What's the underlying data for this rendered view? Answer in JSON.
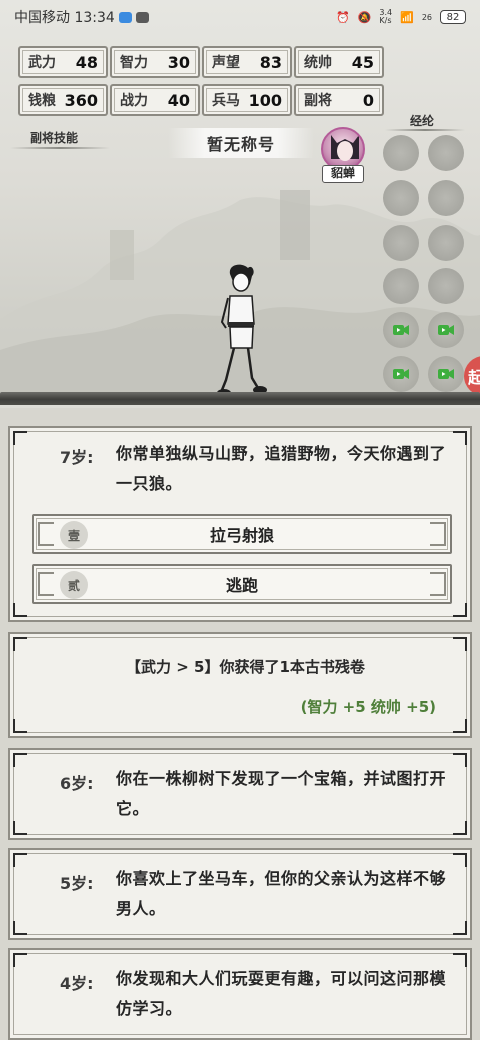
{
  "status_bar": {
    "carrier_time": "中国移动 13:34",
    "network_speed": "3.4\nK/s",
    "signal": "26",
    "battery": "82"
  },
  "stats": [
    {
      "label": "武力",
      "value": "48"
    },
    {
      "label": "智力",
      "value": "30"
    },
    {
      "label": "声望",
      "value": "83"
    },
    {
      "label": "统帅",
      "value": "45"
    },
    {
      "label": "钱粮",
      "value": "360"
    },
    {
      "label": "战力",
      "value": "40"
    },
    {
      "label": "兵马",
      "value": "100"
    },
    {
      "label": "副将",
      "value": "0"
    }
  ],
  "labels": {
    "deputy_skill": "副将技能",
    "jinglun": "经纶",
    "title": "暂无称号"
  },
  "companion": {
    "name": "貂蝉"
  },
  "side_tab": "起",
  "events": {
    "current": {
      "age": "7岁:",
      "text": "你常单独纵马山野，追猎野物，今天你遇到了一只狼。",
      "options": [
        {
          "badge": "壹",
          "label": "拉弓射狼"
        },
        {
          "badge": "贰",
          "label": "逃跑"
        }
      ]
    },
    "result": {
      "text": "【武力 > 5】你获得了1本古书残卷",
      "bonus": "(智力 +5 统帅 +5)"
    },
    "history": [
      {
        "age": "6岁:",
        "text": "你在一株柳树下发现了一个宝箱，并试图打开它。"
      },
      {
        "age": "5岁:",
        "text": "你喜欢上了坐马车，但你的父亲认为这样不够男人。"
      },
      {
        "age": "4岁:",
        "text": "你发现和大人们玩耍更有趣，可以问这问那模仿学习。"
      }
    ]
  },
  "colors": {
    "bonus_green": "#4f7f3a",
    "avatar_accent": "#b45b98",
    "side_tab_red": "#d9534f"
  }
}
